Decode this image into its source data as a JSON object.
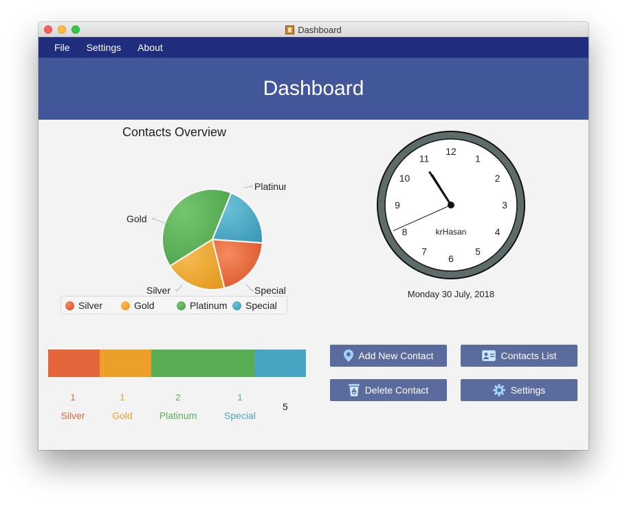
{
  "window": {
    "title": "Dashboard"
  },
  "menu": [
    "File",
    "Settings",
    "About"
  ],
  "header": {
    "title": "Dashboard"
  },
  "chart_data": [
    {
      "type": "pie",
      "title": "Contacts Overview",
      "categories": [
        "Silver",
        "Gold",
        "Platinum",
        "Special"
      ],
      "values": [
        1,
        1,
        2,
        1
      ],
      "colors": [
        "#e2582c",
        "#eda024",
        "#54a850",
        "#43a3c1"
      ],
      "legend": "bottom"
    },
    {
      "type": "bar",
      "stacked": true,
      "orientation": "horizontal",
      "categories": [
        "Silver",
        "Gold",
        "Platinum",
        "Special"
      ],
      "values": [
        1,
        1,
        2,
        1
      ],
      "total": 5,
      "colors": [
        "#e2663a",
        "#eba02a",
        "#58ad55",
        "#46a5c0"
      ]
    }
  ],
  "pie_labels": {
    "silver": "Silver",
    "gold": "Gold",
    "platinum": "Platinum",
    "special": "Special"
  },
  "legend": [
    "Silver",
    "Gold",
    "Platinum",
    "Special"
  ],
  "clock": {
    "numbers": [
      "12",
      "1",
      "2",
      "3",
      "4",
      "5",
      "6",
      "7",
      "8",
      "9",
      "10",
      "11"
    ],
    "label": "krHasan",
    "time": {
      "hour": 10,
      "minute": 54,
      "second": 41
    }
  },
  "date": "Monday 30 July, 2018",
  "summary": {
    "counts": [
      "1",
      "1",
      "2",
      "1"
    ],
    "labels": [
      "Silver",
      "Gold",
      "Platinum",
      "Special"
    ],
    "total": "5"
  },
  "buttons": {
    "add_contact": "Add New Contact",
    "contacts_list": "Contacts List",
    "delete_contact": "Delete Contact",
    "settings": "Settings"
  },
  "icons": {
    "add_contact": "map-pin-icon",
    "contacts_list": "id-card-icon",
    "delete_contact": "recycle-bin-icon",
    "settings": "gear-icon"
  }
}
